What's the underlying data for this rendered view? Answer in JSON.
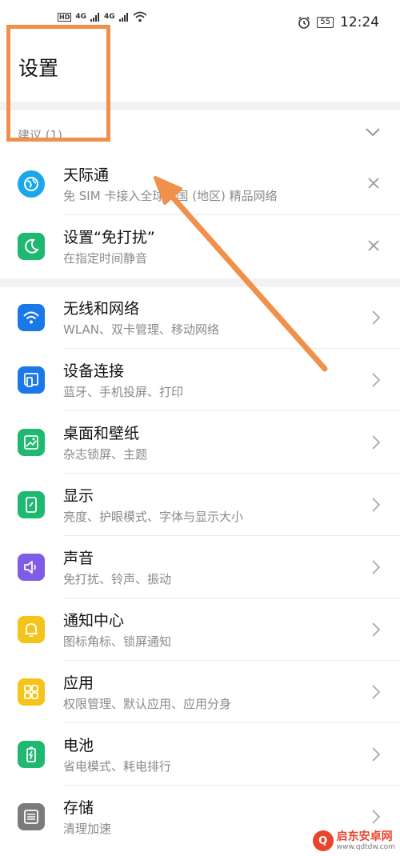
{
  "status_bar": {
    "time": "12:24",
    "battery": "55",
    "network_left": "4G",
    "network_right": "4G",
    "hd": "HD"
  },
  "title": "设置",
  "suggestions": {
    "label": "建议 (1)"
  },
  "suggestion_items": [
    {
      "title": "天际通",
      "subtitle": "免 SIM 卡接入全球多国 (地区) 精品网络",
      "icon": "globe-icon",
      "color": "#19a6ec"
    },
    {
      "title": "设置“免打扰”",
      "subtitle": "在指定时间静音",
      "icon": "moon-icon",
      "color": "#1fb871"
    }
  ],
  "settings_items": [
    {
      "title": "无线和网络",
      "subtitle": "WLAN、双卡管理、移动网络",
      "icon": "wifi-icon",
      "color": "#1a78e8"
    },
    {
      "title": "设备连接",
      "subtitle": "蓝牙、手机投屏、打印",
      "icon": "device-connect-icon",
      "color": "#1a78e8"
    },
    {
      "title": "桌面和壁纸",
      "subtitle": "杂志锁屏、主题",
      "icon": "wallpaper-icon",
      "color": "#1fb871"
    },
    {
      "title": "显示",
      "subtitle": "亮度、护眼模式、字体与显示大小",
      "icon": "display-icon",
      "color": "#1fb871"
    },
    {
      "title": "声音",
      "subtitle": "免打扰、铃声、振动",
      "icon": "sound-icon",
      "color": "#7f5ce6"
    },
    {
      "title": "通知中心",
      "subtitle": "图标角标、锁屏通知",
      "icon": "bell-icon",
      "color": "#f3c41a"
    },
    {
      "title": "应用",
      "subtitle": "权限管理、默认应用、应用分身",
      "icon": "apps-icon",
      "color": "#f3c41a"
    },
    {
      "title": "电池",
      "subtitle": "省电模式、耗电排行",
      "icon": "battery-icon",
      "color": "#1fb871"
    },
    {
      "title": "存储",
      "subtitle": "清理加速",
      "icon": "storage-icon",
      "color": "#7b7b7b"
    }
  ],
  "watermark": {
    "name": "启东安卓网",
    "url": "www.qdtdw.com"
  }
}
